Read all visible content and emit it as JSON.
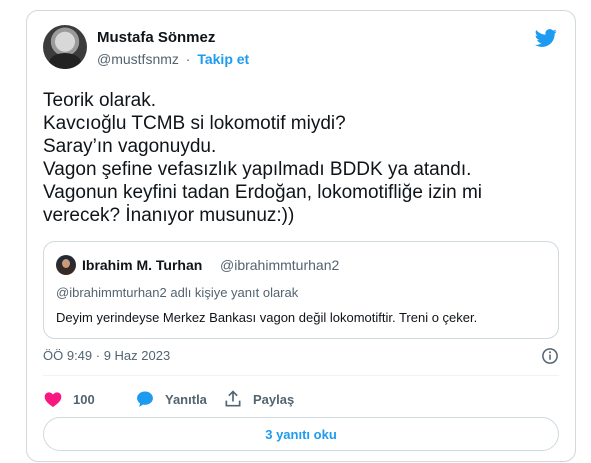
{
  "author": {
    "display_name": "Mustafa Sönmez",
    "handle": "@mustfsnmz",
    "separator": "·",
    "follow_label": "Takip et"
  },
  "tweet": {
    "text": "Teorik olarak.\nKavcıoğlu TCMB si lokomotif miydi?\nSaray’ın vagonuydu.\nVagon şefine vefasızlık yapılmadı BDDK ya atandı.\nVagonun keyfini tadan Erdoğan,  lokomotifliğe izin mi verecek? İnanıyor musunuz:))",
    "timestamp": "ÖÖ 9:49 · 9 Haz 2023"
  },
  "quote": {
    "display_name": "Ibrahim M. Turhan",
    "handle": "@ibrahimmturhan2",
    "reply_context": "@ibrahimmturhan2 adlı kişiye yanıt olarak",
    "text": "Deyim yerindeyse Merkez Bankası vagon değil lokomotiftir. Treni o çeker."
  },
  "actions": {
    "like_count": "100",
    "reply_label": "Yanıtla",
    "share_label": "Paylaş"
  },
  "footer": {
    "read_replies_label": "3 yanıtı oku"
  },
  "colors": {
    "accent": "#1d9bf0",
    "like": "#f91880",
    "text": "#0f1419",
    "muted": "#536471",
    "border": "#cfd9de"
  },
  "icons": [
    "twitter-bird-icon",
    "info-icon",
    "heart-icon",
    "reply-bubble-icon",
    "share-icon"
  ]
}
